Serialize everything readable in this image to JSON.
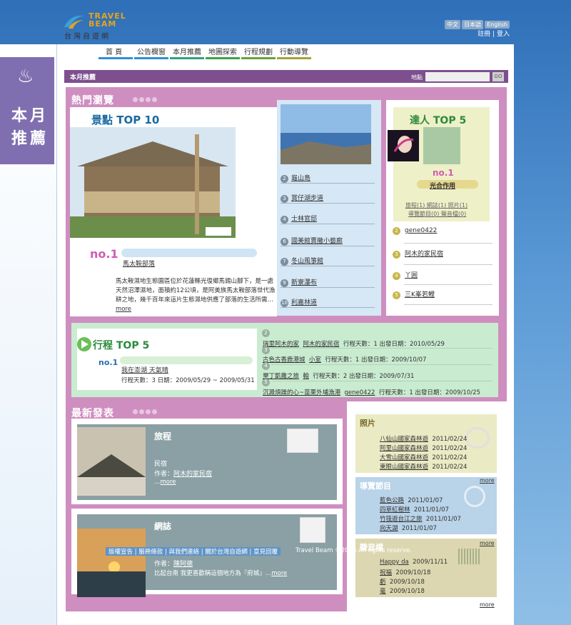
{
  "header": {
    "logo_travel": "TRAVEL",
    "logo_beam": "BEAM",
    "logo_cn": "台灣自遊網",
    "lang": [
      "中文",
      "日本語",
      "English"
    ],
    "register": "註冊",
    "login": "登入",
    "auth_sep": "|"
  },
  "side": {
    "line1": "本月",
    "line2": "推薦"
  },
  "nav": {
    "items": [
      {
        "label": "首  頁",
        "color": "#2f8fd4"
      },
      {
        "label": "公告欄窗",
        "color": "#2f8fd4"
      },
      {
        "label": "本月推薦",
        "color": "#2fa37d"
      },
      {
        "label": "地圖探索",
        "color": "#3aa34a"
      },
      {
        "label": "行程規劃",
        "color": "#6aa33a"
      },
      {
        "label": "行動導覽",
        "color": "#a3a33a"
      }
    ]
  },
  "bar": {
    "title": "本月推薦",
    "loc_label": "地點",
    "go": "GO"
  },
  "popular": {
    "title": "熱門瀏覽",
    "spot_title": "景點 TOP 10",
    "no1": "no.1",
    "no1_name": "馬太鞍部落",
    "no1_desc": "馬太鞍濕地生態園區位於花蓮縣光復鄉馬錫山腳下，是一處天然沼澤濕地，面積約12公頃，是阿美族馬太鞍部落世代漁耕之地，幾千百年來這片生態濕地供應了部落的生活所需…",
    "more": "more",
    "list": [
      {
        "n": "2",
        "name": "龜山島"
      },
      {
        "n": "3",
        "name": "賞仔湖步道"
      },
      {
        "n": "4",
        "name": "士林官邸"
      },
      {
        "n": "6",
        "name": "國美館賣撒小藝廊"
      },
      {
        "n": "7",
        "name": "冬山風箏館"
      },
      {
        "n": "9",
        "name": "新寮瀑布"
      },
      {
        "n": "10",
        "name": "利嘉林道"
      }
    ]
  },
  "expert": {
    "title": "達人 TOP 5",
    "no1": "no.1",
    "name": "光合作用",
    "stats1": "旅程(1)  網誌(1)  照片(1)",
    "stats2": "導覽節目(0)  聲音檔(0)",
    "list": [
      {
        "n": "2",
        "name": "gene0422"
      },
      {
        "n": "3",
        "name": "阿木的家民宿"
      },
      {
        "n": "4",
        "name": "丫囲"
      },
      {
        "n": "5",
        "name": "三K峯若鯉"
      }
    ]
  },
  "trip": {
    "title": "行程 TOP 5",
    "no1": "no.1",
    "name": "我在澎湖 天氣晴",
    "meta": "行程天數：3   日期：2009/05/29 ~ 2009/05/31",
    "list": [
      {
        "n": "2",
        "name": "瑞里阿木的家",
        "author": "阿木的家民宿",
        "meta": "行程天數：1   出發日期：2010/05/29"
      },
      {
        "n": "3",
        "name": "古色古香鹿港城",
        "author": "小室",
        "meta": "行程天數：1   出發日期：2009/10/07"
      },
      {
        "n": "4",
        "name": "墾丁凱撒之旅",
        "author": "翰",
        "meta": "行程天數：2   出發日期：2009/07/31"
      },
      {
        "n": "5",
        "name": "沉澱煩躁的心~苗栗外埔漁港",
        "author": "gene0422",
        "meta": "行程天數：1   出發日期：2009/10/25"
      }
    ]
  },
  "latest": {
    "title": "最新發表",
    "posts": [
      {
        "title": "旅程",
        "line1": "民宿",
        "author_label": "作者：",
        "author": "阿木的家民宿",
        "line2": "…",
        "more": "more"
      },
      {
        "title": "網誌",
        "line1": "",
        "author_label": "作者：",
        "author": "陳阿德",
        "line2": "比起台南  我更喜歡稱這個地方為『府城』…",
        "more": "more"
      }
    ]
  },
  "photos": {
    "title": "照片",
    "rows": [
      {
        "name": "八仙山國家森林遊",
        "date": "2011/02/24"
      },
      {
        "name": "阿里山國家森林遊",
        "date": "2011/02/24"
      },
      {
        "name": "大雪山國家森林遊",
        "date": "2011/02/24"
      },
      {
        "name": "東眼山國家森林遊",
        "date": "2011/02/24"
      }
    ]
  },
  "guide": {
    "title": "導覽節目",
    "more": "more",
    "rows": [
      {
        "name": "藍色公路",
        "date": "2011/01/07"
      },
      {
        "name": "四草紅樹林",
        "date": "2011/01/07"
      },
      {
        "name": "竹筏遊台江之旅",
        "date": "2011/01/07"
      },
      {
        "name": "向天湖",
        "date": "2011/01/07"
      }
    ]
  },
  "sound": {
    "title": "聲音檔",
    "more": "more",
    "rows": [
      {
        "name": "Happy da",
        "date": "2009/11/11"
      },
      {
        "name": "祝福",
        "date": "2009/10/18"
      },
      {
        "name": "虧",
        "date": "2009/10/18"
      },
      {
        "name": "毫",
        "date": "2009/10/18"
      }
    ]
  },
  "bottom_more": "more",
  "footer": {
    "links": "版權宣告 | 服務條款 | 與我們連絡 | 關於台灣自遊網 | 意見回覆",
    "copy": "Travel Beam ©2008 All rights reserve."
  }
}
